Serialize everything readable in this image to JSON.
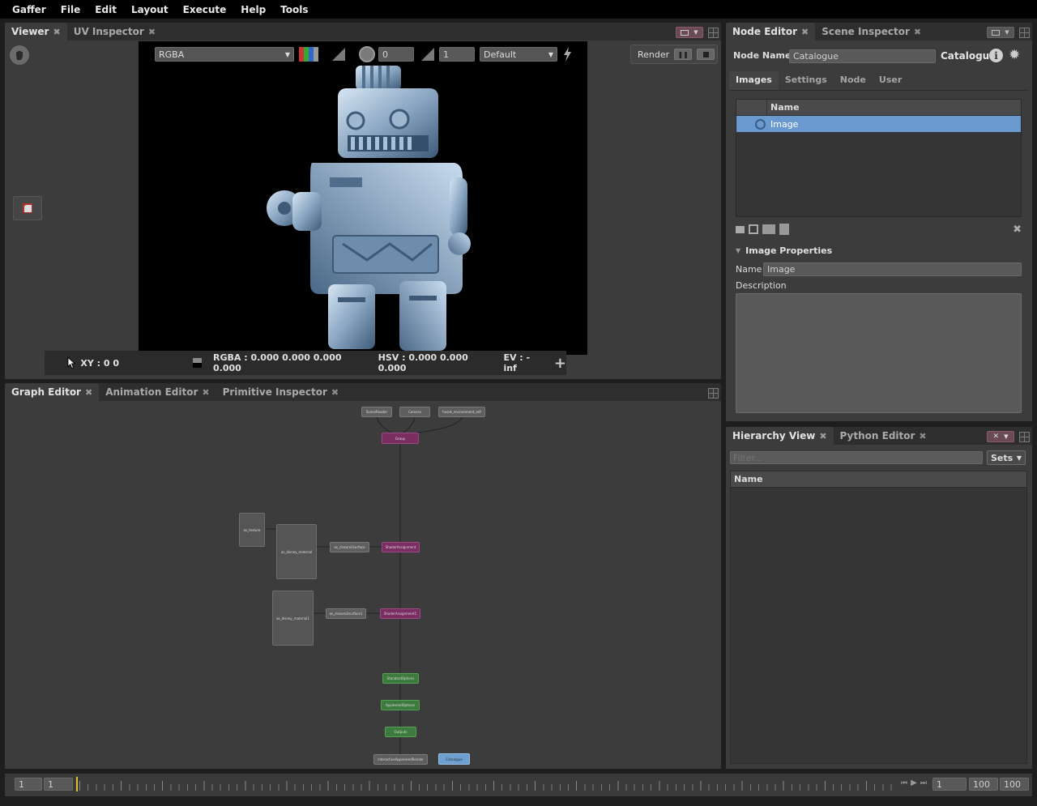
{
  "menu": [
    "Gaffer",
    "File",
    "Edit",
    "Layout",
    "Execute",
    "Help",
    "Tools"
  ],
  "viewer_panel": {
    "tabs": [
      {
        "label": "Viewer",
        "active": true
      },
      {
        "label": "UV Inspector",
        "active": false
      }
    ],
    "channel_dropdown": "RGBA",
    "exposure_value": "0",
    "gamma_value": "1",
    "display_transform": "Default",
    "render_label": "Render",
    "status": {
      "xy": "XY : 0 0",
      "rgba": "RGBA : 0.000 0.000 0.000 0.000",
      "hsv": "HSV : 0.000 0.000 0.000",
      "ev": "EV : -inf"
    }
  },
  "node_editor": {
    "tabs": [
      {
        "label": "Node Editor",
        "active": true
      },
      {
        "label": "Scene Inspector",
        "active": false
      }
    ],
    "node_name_label": "Node Name",
    "node_name_value": "Catalogue",
    "node_type": "Catalogue",
    "sub_tabs": [
      "Images",
      "Settings",
      "Node",
      "User"
    ],
    "list_header": "Name",
    "list_items": [
      "Image"
    ],
    "section_title": "Image Properties",
    "name_label": "Name",
    "name_value": "Image",
    "description_label": "Description"
  },
  "graph_editor": {
    "tabs": [
      {
        "label": "Graph Editor",
        "active": true
      },
      {
        "label": "Animation Editor",
        "active": false
      },
      {
        "label": "Primitive Inspector",
        "active": false
      }
    ],
    "nodes": {
      "scenereader": "SceneReader",
      "camera": "Camera",
      "environment": "hosek_environment_edf",
      "group": "Group",
      "texture": "as_texture",
      "disney_material": "as_disney_material",
      "closure_surface": "as_closure2surface",
      "shader_assignment": "ShaderAssignment",
      "disney_material1": "as_disney_material1",
      "closure_surface1": "as_closure2surface1",
      "shader_assignment1": "ShaderAssignment1",
      "standard_options": "StandardOptions",
      "appleseed_options": "AppleseedOptions",
      "outputs": "Outputs",
      "interactive_render": "InteractiveAppleseedRender",
      "catalogue": "Catalogue"
    }
  },
  "hierarchy_view": {
    "tabs": [
      {
        "label": "Hierarchy View",
        "active": true
      },
      {
        "label": "Python Editor",
        "active": false
      }
    ],
    "filter_placeholder": "Filter...",
    "sets_label": "Sets",
    "column_header": "Name"
  },
  "timeline": {
    "start_outer": "1",
    "start_inner": "1",
    "current_frame": "1",
    "end_inner": "100",
    "end_outer": "100"
  }
}
